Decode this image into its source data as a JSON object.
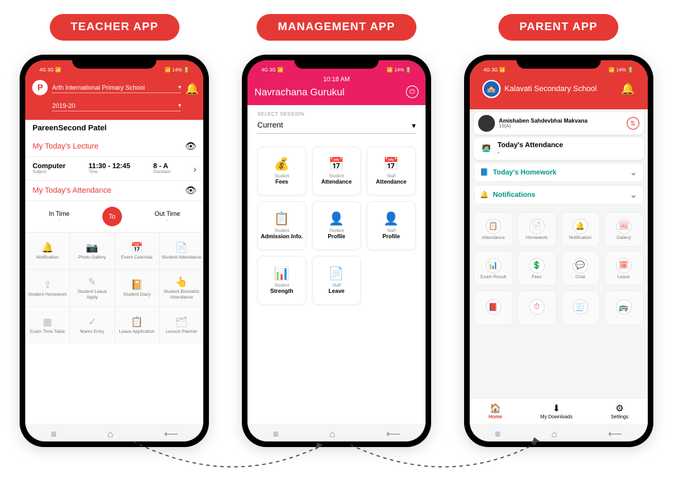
{
  "pills": {
    "teacher": "TEACHER APP",
    "management": "MANAGEMENT APP",
    "parent": "PARENT APP"
  },
  "status": {
    "left": "4G  3G 📶",
    "right": "📶 14% 🔋",
    "time": "10:18 AM"
  },
  "teacher": {
    "avatar": "P",
    "school": "Arth International Primary School",
    "year": "2019-20",
    "student": "PareenSecond  Patel",
    "lect_title": "My Today's Lecture",
    "subject": "Computer",
    "subject_lbl": "Subject",
    "time": "11:30 - 12:45",
    "time_lbl": "Time",
    "standard": "8 - A",
    "standard_lbl": "Standard",
    "att_title": "My Today's Attendance",
    "in_lbl": "In Time",
    "out_lbl": "Out Time",
    "to": "To",
    "dash": "-",
    "grid": [
      "Notification",
      "Photo Gallery",
      "Event Calendar",
      "Student Attendance",
      "Student Homework",
      "Student Leave Apply",
      "Student Diary",
      "Student Biometric Attendance",
      "Exam Time Table",
      "Marks Entry",
      "Leave Application",
      "Lesson Planner"
    ]
  },
  "management": {
    "school": "Navrachana Gurukul",
    "session_lbl": "SELECT SESSION",
    "session_val": "Current",
    "cards": [
      {
        "top": "Student",
        "bot": "Fees",
        "ico": "💰"
      },
      {
        "top": "Student",
        "bot": "Attendance",
        "ico": "📅"
      },
      {
        "top": "Staff",
        "bot": "Attendance",
        "ico": "📅"
      },
      {
        "top": "Student",
        "bot": "Admission Info.",
        "ico": "📋"
      },
      {
        "top": "Student",
        "bot": "Profile",
        "ico": "👤"
      },
      {
        "top": "Staff",
        "bot": "Profile",
        "ico": "👤"
      },
      {
        "top": "Student",
        "bot": "Strength",
        "ico": "📊"
      },
      {
        "top": "Staff",
        "bot": "Leave",
        "ico": "📄"
      }
    ]
  },
  "parent": {
    "school": "Kalavati Secondary School",
    "user": "Amishaben Sahdevbhai Makvana",
    "class": "10(A)",
    "today_att": "Today's Attendance",
    "today_att_val": "-",
    "today_hw": "Today's Homework",
    "notif": "Notifications",
    "grid": [
      "Attendance",
      "Homework",
      "Notification",
      "Gallery",
      "Exam Result",
      "Fees",
      "Chat",
      "Leave",
      "",
      "",
      "",
      ""
    ],
    "nav": [
      "Home",
      "My Downloads",
      "Settings"
    ]
  },
  "sysnav": {
    "menu": "≡",
    "home": "⌂",
    "back": "⟵"
  }
}
